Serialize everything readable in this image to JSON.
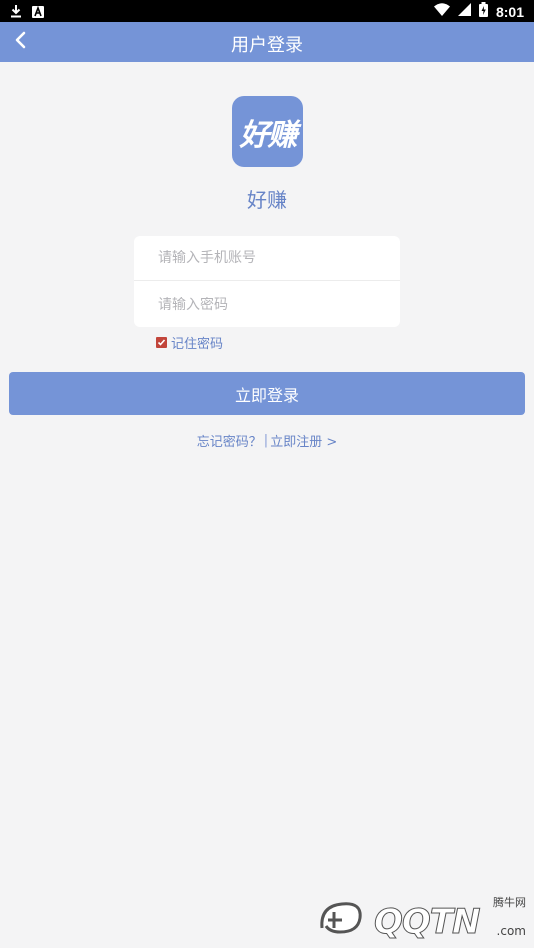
{
  "status_bar": {
    "left_icons": [
      "download-icon",
      "a-icon"
    ],
    "right_icons": [
      "wifi-icon",
      "signal-icon",
      "battery-icon"
    ],
    "time": "8:01"
  },
  "nav": {
    "back_icon": "chevron-left-icon",
    "title": "用户登录"
  },
  "logo": {
    "text": "好赚",
    "color": "#7594d7"
  },
  "app_name": "好赚",
  "form": {
    "phone_placeholder": "请输入手机账号",
    "phone_value": "",
    "password_placeholder": "请输入密码",
    "password_value": ""
  },
  "remember": {
    "label": "记住密码",
    "checked": true
  },
  "login_button": "立即登录",
  "links": {
    "forgot": "忘记密码？",
    "separator": "|",
    "register": "立即注册 >"
  },
  "watermark": {
    "text": "QQTN",
    "badge": "腾牛网",
    "suffix": ".com"
  },
  "colors": {
    "primary": "#7594d7",
    "link": "#6784c7",
    "checkbox": "#c2453b",
    "background": "#f4f4f5"
  }
}
